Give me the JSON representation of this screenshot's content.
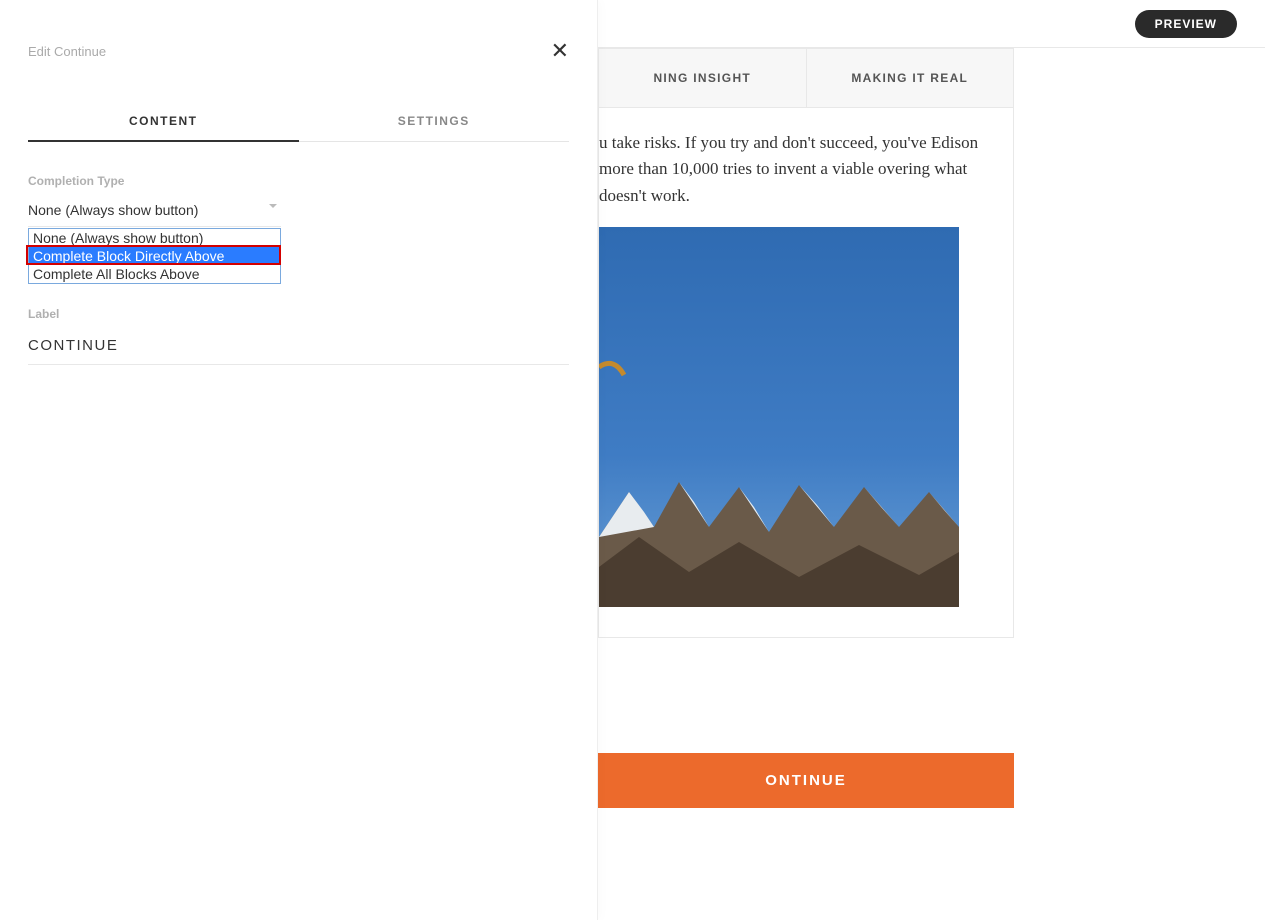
{
  "topbar": {
    "preview_label": "PREVIEW"
  },
  "content": {
    "tabs": [
      {
        "label": "NING INSIGHT"
      },
      {
        "label": "MAKING IT REAL"
      }
    ],
    "paragraph": "u take risks. If you try and don't succeed, you've Edison more than 10,000 tries to invent a viable overing what doesn't work.",
    "continue_label": "ONTINUE"
  },
  "panel": {
    "title": "Edit Continue",
    "tabs": {
      "content": "CONTENT",
      "settings": "SETTINGS"
    },
    "completion_type_label": "Completion Type",
    "completion_type_selected": "None (Always show button)",
    "dropdown_options": [
      "None (Always show button)",
      "Complete Block Directly Above",
      "Complete All Blocks Above"
    ],
    "label_field_label": "Label",
    "label_field_value": "CONTINUE"
  }
}
